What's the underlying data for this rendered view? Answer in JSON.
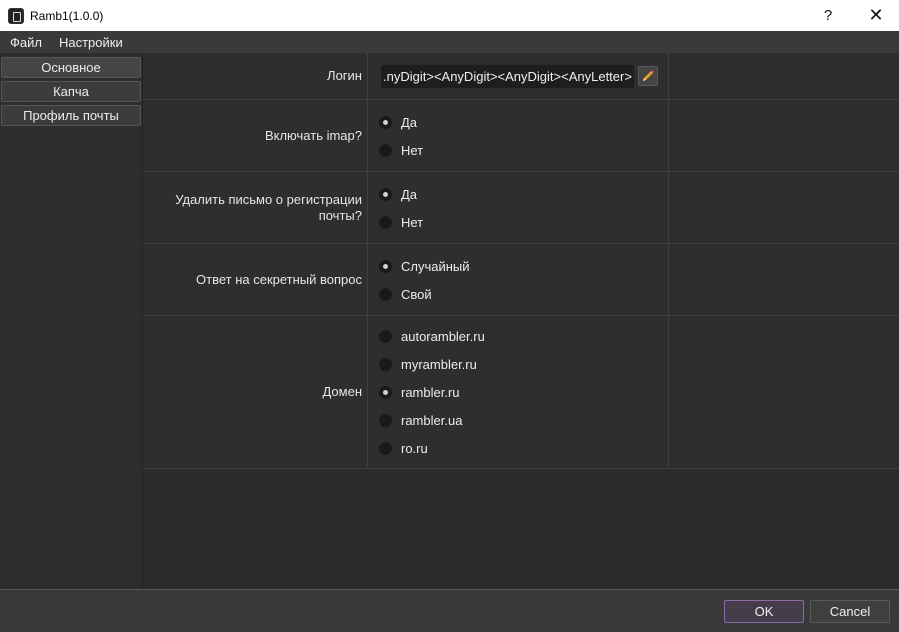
{
  "window": {
    "title": "Ramb1(1.0.0)",
    "help_label": "?",
    "close_label": "✕"
  },
  "menu": {
    "items": [
      "Файл",
      "Настройки"
    ]
  },
  "sidebar": {
    "items": [
      "Основное",
      "Капча",
      "Профиль почты"
    ]
  },
  "form": {
    "login": {
      "label": "Логин",
      "value": ".nyDigit><AnyDigit><AnyDigit><AnyLetter>"
    },
    "imap": {
      "label": "Включать imap?",
      "options": [
        "Да",
        "Нет"
      ],
      "selected": "Да"
    },
    "delete_mail": {
      "label": "Удалить письмо о регистрации почты?",
      "options": [
        "Да",
        "Нет"
      ],
      "selected": "Да"
    },
    "secret_answer": {
      "label": "Ответ на секретный вопрос",
      "options": [
        "Случайный",
        "Свой"
      ],
      "selected": "Случайный"
    },
    "domain": {
      "label": "Домен",
      "options": [
        "autorambler.ru",
        "myrambler.ru",
        "rambler.ru",
        "rambler.ua",
        "ro.ru"
      ],
      "selected": "rambler.ru"
    }
  },
  "footer": {
    "ok_label": "OK",
    "cancel_label": "Cancel"
  },
  "icons": {
    "app": "app-icon",
    "edit": "pencil-icon"
  },
  "colors": {
    "background": "#2b2b2b",
    "titlebar": "#ffffff",
    "ok_border": "#8e6aa8"
  }
}
